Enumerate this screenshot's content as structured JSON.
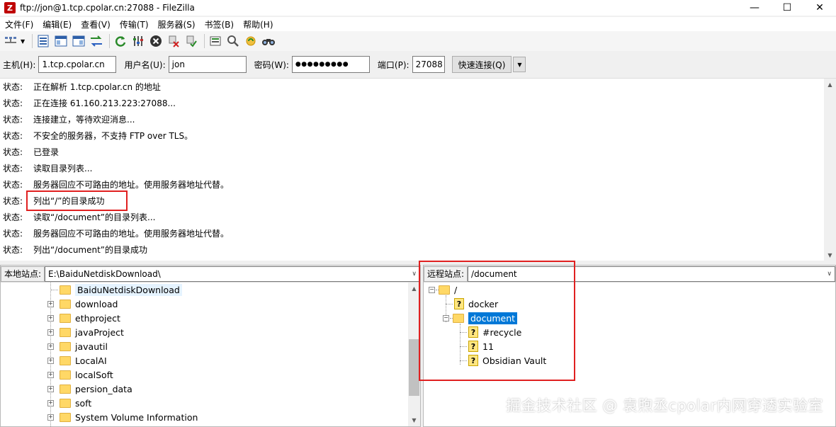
{
  "window": {
    "title": "ftp://jon@1.tcp.cpolar.cn:27088 - FileZilla",
    "icon": "filezilla-icon"
  },
  "menu": [
    "文件(F)",
    "编辑(E)",
    "查看(V)",
    "传输(T)",
    "服务器(S)",
    "书签(B)",
    "帮助(H)"
  ],
  "quickconnect": {
    "host_label": "主机(H):",
    "host_value": "1.tcp.cpolar.cn",
    "user_label": "用户名(U):",
    "user_value": "jon",
    "pass_label": "密码(W):",
    "pass_value": "●●●●●●●●●",
    "port_label": "端口(P):",
    "port_value": "27088",
    "connect_label": "快速连接(Q)"
  },
  "log": [
    {
      "type": "状态:",
      "msg": "正在解析 1.tcp.cpolar.cn 的地址"
    },
    {
      "type": "状态:",
      "msg": "正在连接 61.160.213.223:27088..."
    },
    {
      "type": "状态:",
      "msg": "连接建立，等待欢迎消息..."
    },
    {
      "type": "状态:",
      "msg": "不安全的服务器，不支持 FTP over TLS。"
    },
    {
      "type": "状态:",
      "msg": "已登录"
    },
    {
      "type": "状态:",
      "msg": "读取目录列表..."
    },
    {
      "type": "状态:",
      "msg": "服务器回应不可路由的地址。使用服务器地址代替。"
    },
    {
      "type": "状态:",
      "msg": "列出“/”的目录成功"
    },
    {
      "type": "状态:",
      "msg": "读取“/document”的目录列表..."
    },
    {
      "type": "状态:",
      "msg": "服务器回应不可路由的地址。使用服务器地址代替。"
    },
    {
      "type": "状态:",
      "msg": "列出“/document”的目录成功"
    }
  ],
  "local": {
    "label": "本地站点:",
    "path": "E:\\BaiduNetdiskDownload\\",
    "tree": [
      "BaiduNetdiskDownload",
      "download",
      "ethproject",
      "javaProject",
      "javautil",
      "LocalAI",
      "localSoft",
      "persion_data",
      "soft",
      "System Volume Information"
    ]
  },
  "remote": {
    "label": "远程站点:",
    "path": "/document",
    "tree": {
      "root": "/",
      "docker": "docker",
      "document": "document",
      "children": [
        "#recycle",
        "11",
        "Obsidian Vault"
      ]
    }
  },
  "watermark": "掘金技术社区 @ 袁煦丞cpolar内网穿透实验室",
  "colors": {
    "selection": "#0078d7",
    "highlight_box": "#e02020",
    "folder": "#ffd866"
  }
}
